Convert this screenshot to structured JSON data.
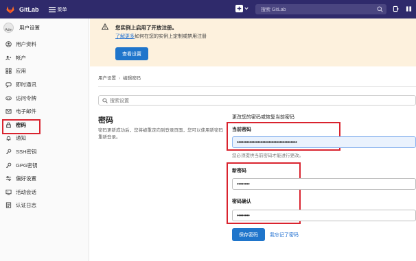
{
  "topbar": {
    "brand": "GitLab",
    "menu_label": "菜单",
    "search_placeholder": "搜索 GitLab"
  },
  "sidebar": {
    "avatar_text": "Adm",
    "title": "用户设置",
    "items": [
      {
        "label": "用户资料",
        "icon": "user-icon"
      },
      {
        "label": "帐户",
        "icon": "account-icon"
      },
      {
        "label": "应用",
        "icon": "applications-icon"
      },
      {
        "label": "即时通讯",
        "icon": "chat-icon"
      },
      {
        "label": "访问令牌",
        "icon": "token-icon"
      },
      {
        "label": "电子邮件",
        "icon": "mail-icon"
      },
      {
        "label": "密码",
        "icon": "lock-icon"
      },
      {
        "label": "通知",
        "icon": "bell-icon"
      },
      {
        "label": "SSH密钥",
        "icon": "key-icon"
      },
      {
        "label": "GPG密钥",
        "icon": "key-icon"
      },
      {
        "label": "偏好设置",
        "icon": "preferences-icon"
      },
      {
        "label": "活动会话",
        "icon": "sessions-icon"
      },
      {
        "label": "认证日志",
        "icon": "log-icon"
      }
    ]
  },
  "banner": {
    "title": "您实例上启用了开放注册。",
    "link": "了解更多",
    "text": "如何在您的实例上定制或禁用注册",
    "button": "查看设置"
  },
  "breadcrumb": {
    "parent": "用户设置",
    "current": "编辑密码"
  },
  "search": {
    "placeholder": "搜索设置"
  },
  "section": {
    "title": "密码",
    "description": "密码更新成功后，您将被重定向到登录页面，您可以使用新密码重新登录。"
  },
  "form": {
    "heading": "更改您的密码或恢复当前密码",
    "current_label": "当前密码",
    "current_value": "••••••••••••••••••••••••••••••••••••••",
    "current_hint": "您必须提供当前密码才能进行更改。",
    "new_label": "新密码",
    "new_value": "••••••••",
    "confirm_label": "密码确认",
    "confirm_value": "••••••••",
    "save_button": "保存密码",
    "forgot_link": "我忘记了密码"
  },
  "colors": {
    "topbar": "#2f2a6b",
    "primary": "#1f75cb",
    "banner": "#fdf1dd",
    "highlight": "#d9232e"
  }
}
